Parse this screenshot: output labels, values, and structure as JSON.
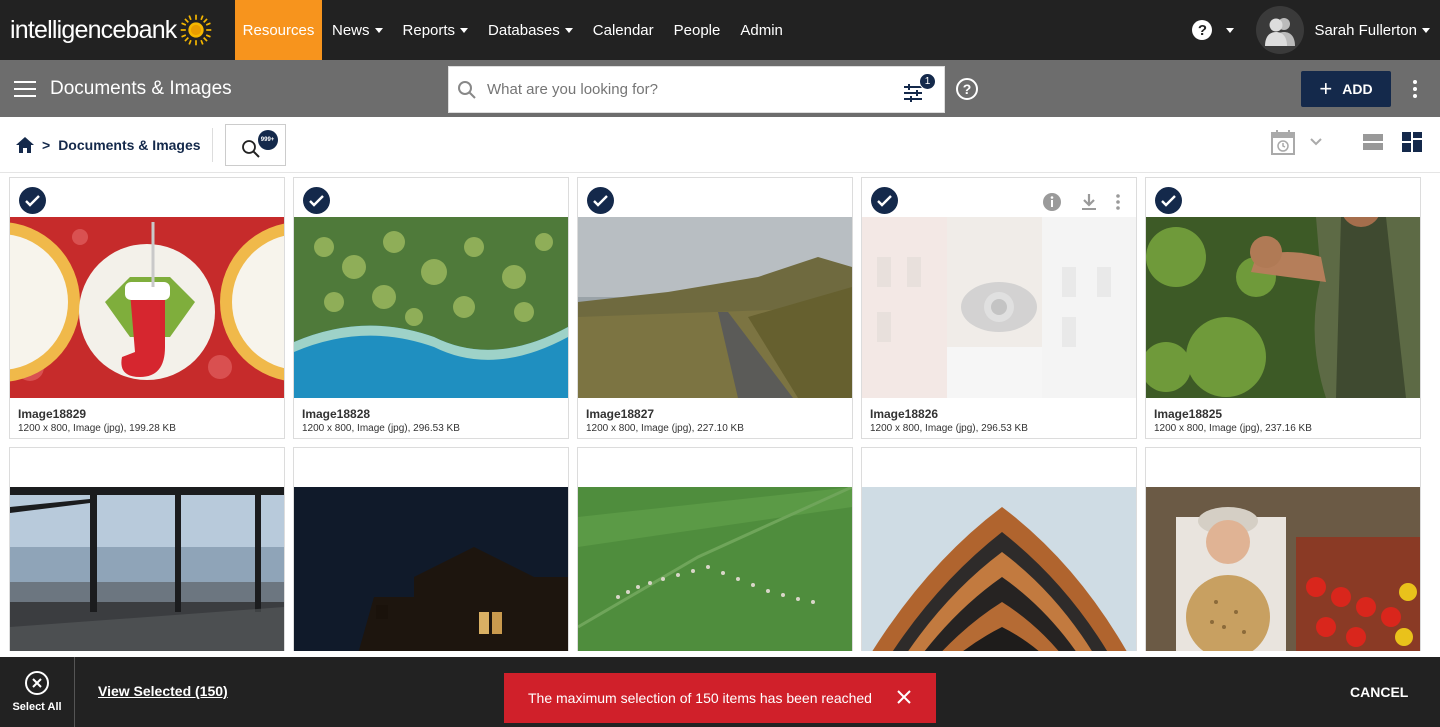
{
  "brand": {
    "logo_text": "intelligencebank"
  },
  "topnav": {
    "items": [
      {
        "label": "Resources",
        "active": true,
        "dropdown": false
      },
      {
        "label": "News",
        "dropdown": true
      },
      {
        "label": "Reports",
        "dropdown": true
      },
      {
        "label": "Databases",
        "dropdown": true
      },
      {
        "label": "Calendar",
        "dropdown": false
      },
      {
        "label": "People",
        "dropdown": false
      },
      {
        "label": "Admin",
        "dropdown": false
      }
    ],
    "help_icon": "question-circle-icon",
    "user_name": "Sarah Fullerton"
  },
  "subheader": {
    "title": "Documents & Images",
    "search_placeholder": "What are you looking for?",
    "filter_count": "1",
    "add_label": "ADD"
  },
  "breadcrumb": {
    "current": "Documents & Images",
    "separator": ">",
    "search_badge": "999+"
  },
  "cards": [
    {
      "name": "Image18829",
      "meta": "1200 x 800, Image (jpg), 199.28 KB",
      "selected": true,
      "hover": false
    },
    {
      "name": "Image18828",
      "meta": "1200 x 800, Image (jpg), 296.53 KB",
      "selected": true,
      "hover": false
    },
    {
      "name": "Image18827",
      "meta": "1200 x 800, Image (jpg), 227.10 KB",
      "selected": true,
      "hover": false
    },
    {
      "name": "Image18826",
      "meta": "1200 x 800, Image (jpg), 296.53 KB",
      "selected": true,
      "hover": true
    },
    {
      "name": "Image18825",
      "meta": "1200 x 800, Image (jpg), 237.16 KB",
      "selected": true,
      "hover": false
    },
    {
      "name": "",
      "meta": "",
      "selected": false
    },
    {
      "name": "",
      "meta": "",
      "selected": false
    },
    {
      "name": "",
      "meta": "",
      "selected": false
    },
    {
      "name": "",
      "meta": "",
      "selected": false
    },
    {
      "name": "",
      "meta": "",
      "selected": false
    }
  ],
  "bottombar": {
    "select_all_label": "Select All",
    "view_selected": "View Selected (150)",
    "toast_message": "The maximum selection of 150 items has been reached",
    "cancel_label": "CANCEL"
  },
  "colors": {
    "accent_orange": "#f7941d",
    "navy": "#14294b",
    "toast_red": "#d0202a",
    "topbar": "#222222",
    "subheader": "#6d6d6d"
  }
}
